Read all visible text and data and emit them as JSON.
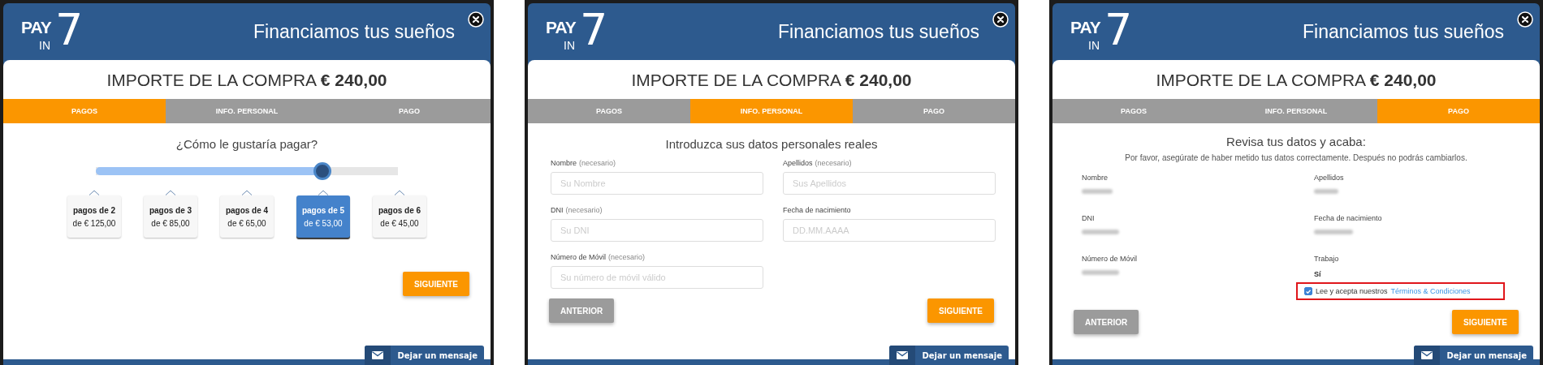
{
  "panels": [
    {
      "kind": "installments",
      "logo": {
        "top": "PAY",
        "bottom": "IN",
        "mark": "7"
      },
      "header_title": "Financiamos tus sueños",
      "amount_label": "IMPORTE DE LA COMPRA",
      "amount": "€ 240,00",
      "tabs": [
        {
          "label": "PAGOS",
          "selected": true
        },
        {
          "label": "INFO. PERSONAL",
          "selected": false
        },
        {
          "label": "PAGO",
          "selected": false
        }
      ],
      "heading": "¿Cómo le gustaría pagar?",
      "slider": {
        "level": 0.75
      },
      "options": [
        {
          "title": "pagos de 2",
          "amount": "de € 125,00",
          "selected": false
        },
        {
          "title": "pagos de 3",
          "amount": "de € 85,00",
          "selected": false
        },
        {
          "title": "pagos de 4",
          "amount": "de € 65,00",
          "selected": false
        },
        {
          "title": "pagos de 5",
          "amount": "de € 53,00",
          "selected": true
        },
        {
          "title": "pagos de 6",
          "amount": "de € 45,00",
          "selected": false
        }
      ],
      "buttons": [
        {
          "label": "SIGUIENTE",
          "kind": "primary"
        }
      ],
      "chat_button": "Dejar un mensaje"
    },
    {
      "kind": "personal_form",
      "logo": {
        "top": "PAY",
        "bottom": "IN",
        "mark": "7"
      },
      "header_title": "Financiamos tus sueños",
      "amount_label": "IMPORTE DE LA COMPRA",
      "amount": "€ 240,00",
      "tabs": [
        {
          "label": "PAGOS",
          "selected": false
        },
        {
          "label": "INFO. PERSONAL",
          "selected": true
        },
        {
          "label": "PAGO",
          "selected": false
        }
      ],
      "heading": "Introduzca sus datos personales reales",
      "fields": [
        {
          "label": "Nombre",
          "note": "(necesario)",
          "placeholder": "Su Nombre"
        },
        {
          "label": "Apellidos",
          "note": "(necesario)",
          "placeholder": "Sus Apellidos"
        },
        {
          "label": "DNI",
          "note": "(necesario)",
          "placeholder": "Su DNI"
        },
        {
          "label": "Fecha de nacimiento",
          "placeholder": "DD.MM.AAAA"
        },
        {
          "label": "Número de Móvil",
          "note": "(necesario)",
          "placeholder": "Su número de móvil válido"
        }
      ],
      "buttons": [
        {
          "label": "ANTERIOR",
          "kind": "secondary"
        },
        {
          "label": "SIGUIENTE",
          "kind": "primary"
        }
      ],
      "chat_button": "Dejar un mensaje"
    },
    {
      "kind": "review",
      "logo": {
        "top": "PAY",
        "bottom": "IN",
        "mark": "7"
      },
      "header_title": "Financiamos tus sueños",
      "amount_label": "IMPORTE DE LA COMPRA",
      "amount": "€ 240,00",
      "tabs": [
        {
          "label": "PAGOS",
          "selected": false
        },
        {
          "label": "INFO. PERSONAL",
          "selected": false
        },
        {
          "label": "PAGO",
          "selected": true
        }
      ],
      "heading": "Revisa tus datos y acaba:",
      "subheading": "Por favor, asegúrate de haber metido tus datos correctamente. Después no podrás cambiarlos.",
      "fields": [
        {
          "label": "Nombre",
          "kind": "blurred"
        },
        {
          "label": "Apellidos",
          "kind": "blurred"
        },
        {
          "label": "DNI",
          "kind": "blurred"
        },
        {
          "label": "Fecha de nacimiento",
          "kind": "blurred"
        },
        {
          "label": "Número de Móvil",
          "kind": "blurred"
        },
        {
          "label": "Trabajo",
          "kind": "text",
          "value": "Sí"
        }
      ],
      "terms": {
        "checked": true,
        "highlighted": true,
        "text": "Lee y acepta nuestros",
        "link": "Términos & Condiciones"
      },
      "buttons": [
        {
          "label": "ANTERIOR",
          "kind": "secondary"
        },
        {
          "label": "SIGUIENTE",
          "kind": "primary"
        }
      ],
      "chat_button": "Dejar un mensaje"
    }
  ]
}
